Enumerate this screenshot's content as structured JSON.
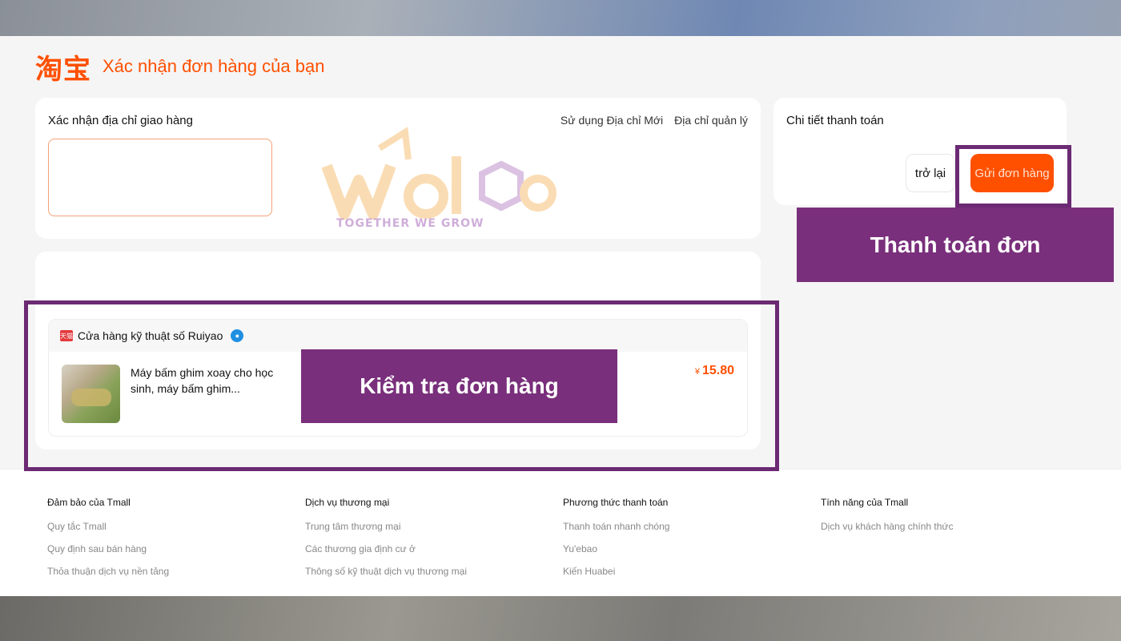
{
  "header": {
    "logo": "淘宝",
    "title": "Xác nhận đơn hàng của bạn"
  },
  "address": {
    "title": "Xác nhận địa chỉ giao hàng",
    "links": [
      "Sử dụng Địa chỉ Mới",
      "Địa chỉ quản lý"
    ]
  },
  "order": {
    "shop_badge": "天猫",
    "shop_name": "Cửa hàng kỹ thuật số Ruiyao",
    "item_name": "Máy bấm ghim xoay cho học sinh, máy bấm ghim...",
    "currency": "¥",
    "price": "15.80"
  },
  "payment": {
    "title": "Chi tiết thanh toán",
    "back_label": "trở lại",
    "submit_label": "Gửi đơn hàng"
  },
  "overlays": {
    "pay_label": "Thanh toán đơn",
    "order_label": "Kiểm tra đơn hàng"
  },
  "watermark": {
    "brand": "welog",
    "tagline": "TOGETHER WE GROW"
  },
  "footer": {
    "columns": [
      {
        "heading": "Đảm bảo của Tmall",
        "links": [
          "Quy tắc Tmall",
          "Quy định sau bán hàng",
          "Thỏa thuận dịch vụ nền tảng"
        ]
      },
      {
        "heading": "Dịch vụ thương mại",
        "links": [
          "Trung tâm thương mại",
          "Các thương gia định cư ở",
          "Thông số kỹ thuật dịch vụ thương mại"
        ]
      },
      {
        "heading": "Phương thức thanh toán",
        "links": [
          "Thanh toán nhanh chóng",
          "Yu'ebao",
          "Kiến Huabei"
        ]
      },
      {
        "heading": "Tính năng của Tmall",
        "links": [
          "Dịch vụ khách hàng chính thức"
        ]
      }
    ]
  },
  "colors": {
    "accent": "#ff5000",
    "highlight": "#792f7b"
  }
}
